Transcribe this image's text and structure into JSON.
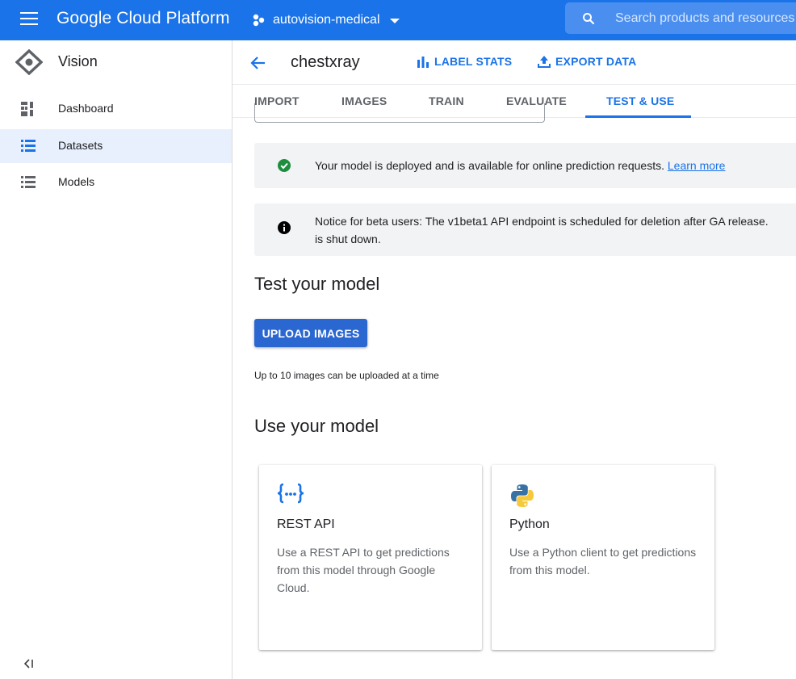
{
  "topbar": {
    "app_name": "Google Cloud Platform",
    "project_name": "autovision-medical",
    "search_placeholder": "Search products and resources",
    "colors": {
      "bar": "#1a73e8"
    }
  },
  "sidebar": {
    "title": "Vision",
    "items": [
      {
        "label": "Dashboard",
        "icon": "dashboard-icon",
        "active": false
      },
      {
        "label": "Datasets",
        "icon": "list-icon",
        "active": true
      },
      {
        "label": "Models",
        "icon": "list-icon",
        "active": false
      }
    ],
    "collapse_icon": "collapse-sidebar-icon"
  },
  "header": {
    "title": "chestxray",
    "actions": [
      {
        "label": "LABEL STATS",
        "icon": "bar-chart-icon"
      },
      {
        "label": "EXPORT DATA",
        "icon": "upload-icon"
      }
    ]
  },
  "tabs": [
    {
      "label": "IMPORT",
      "active": false
    },
    {
      "label": "IMAGES",
      "active": false
    },
    {
      "label": "TRAIN",
      "active": false
    },
    {
      "label": "EVALUATE",
      "active": false
    },
    {
      "label": "TEST & USE",
      "active": true
    }
  ],
  "notices": {
    "deployed": {
      "text": "Your model is deployed and is available for online prediction requests.",
      "link": "Learn more",
      "icon": "check-circle-icon"
    },
    "beta": {
      "line1": "Notice for beta users: The v1beta1 API endpoint is scheduled for deletion after GA release.",
      "line2": "is shut down.",
      "icon": "info-icon"
    }
  },
  "test_section": {
    "heading": "Test your model",
    "button": "UPLOAD IMAGES",
    "hint": "Up to 10 images can be uploaded at a time"
  },
  "use_section": {
    "heading": "Use your model",
    "cards": [
      {
        "title": "REST API",
        "icon": "code-braces-icon",
        "description": "Use a REST API to get predictions from this model through Google Cloud."
      },
      {
        "title": "Python",
        "icon": "python-logo-icon",
        "description": "Use a Python client to get predictions from this model."
      }
    ]
  }
}
